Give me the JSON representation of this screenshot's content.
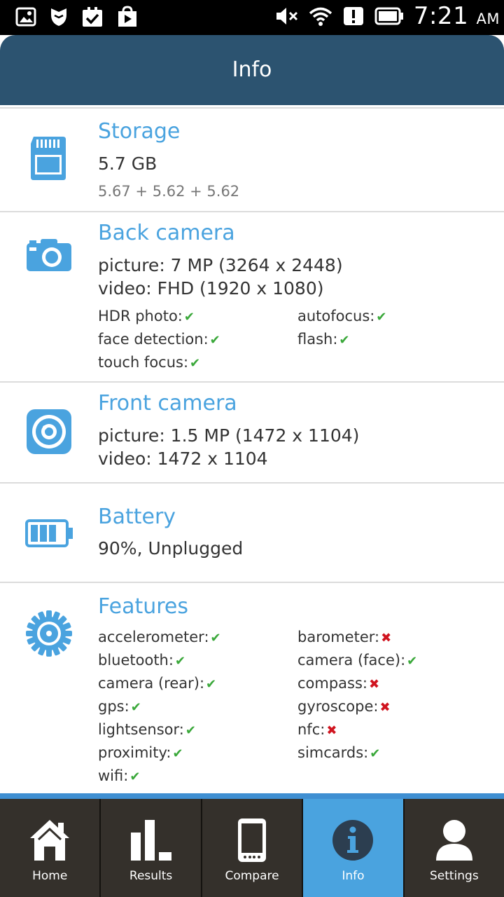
{
  "status_bar": {
    "time": "7:21",
    "ampm": "AM",
    "icons": [
      "gallery-icon",
      "shield-icon",
      "task-check-icon",
      "play-store-icon",
      "mute-icon",
      "wifi-icon",
      "alert-icon",
      "battery-icon"
    ]
  },
  "header": {
    "title": "Info"
  },
  "storage": {
    "title": "Storage",
    "value": "5.7 GB",
    "detail": "5.67 + 5.62 + 5.62"
  },
  "back_camera": {
    "title": "Back camera",
    "picture": "picture: 7 MP (3264 x 2448)",
    "video": "video: FHD (1920 x 1080)",
    "features": [
      {
        "label": "HDR photo:",
        "supported": true
      },
      {
        "label": "autofocus:",
        "supported": true
      },
      {
        "label": "face detection:",
        "supported": true
      },
      {
        "label": "flash:",
        "supported": true
      },
      {
        "label": "touch focus:",
        "supported": true
      }
    ]
  },
  "front_camera": {
    "title": "Front camera",
    "picture": "picture: 1.5 MP (1472 x 1104)",
    "video": "video: 1472 x 1104"
  },
  "battery": {
    "title": "Battery",
    "status": "90%, Unplugged"
  },
  "features": {
    "title": "Features",
    "items": [
      {
        "label": "accelerometer:",
        "supported": true
      },
      {
        "label": "barometer:",
        "supported": false
      },
      {
        "label": "bluetooth:",
        "supported": true
      },
      {
        "label": "camera (face):",
        "supported": true
      },
      {
        "label": "camera (rear):",
        "supported": true
      },
      {
        "label": "compass:",
        "supported": false
      },
      {
        "label": "gps:",
        "supported": true
      },
      {
        "label": "gyroscope:",
        "supported": false
      },
      {
        "label": "lightsensor:",
        "supported": true
      },
      {
        "label": "nfc:",
        "supported": false
      },
      {
        "label": "proximity:",
        "supported": true
      },
      {
        "label": "simcards:",
        "supported": true
      },
      {
        "label": "wifi:",
        "supported": true
      }
    ]
  },
  "marks": {
    "yes": "✔",
    "no": "✖"
  },
  "bottom_nav": {
    "tabs": [
      {
        "label": "Home",
        "icon": "home-icon"
      },
      {
        "label": "Results",
        "icon": "bar-chart-icon"
      },
      {
        "label": "Compare",
        "icon": "phone-icon"
      },
      {
        "label": "Info",
        "icon": "info-icon",
        "active": true
      },
      {
        "label": "Settings",
        "icon": "user-icon"
      }
    ]
  },
  "colors": {
    "accent": "#4aa3df",
    "header": "#2c5370",
    "nav_bg": "#34302b",
    "check": "#3aa83a",
    "cross": "#d0141f"
  }
}
